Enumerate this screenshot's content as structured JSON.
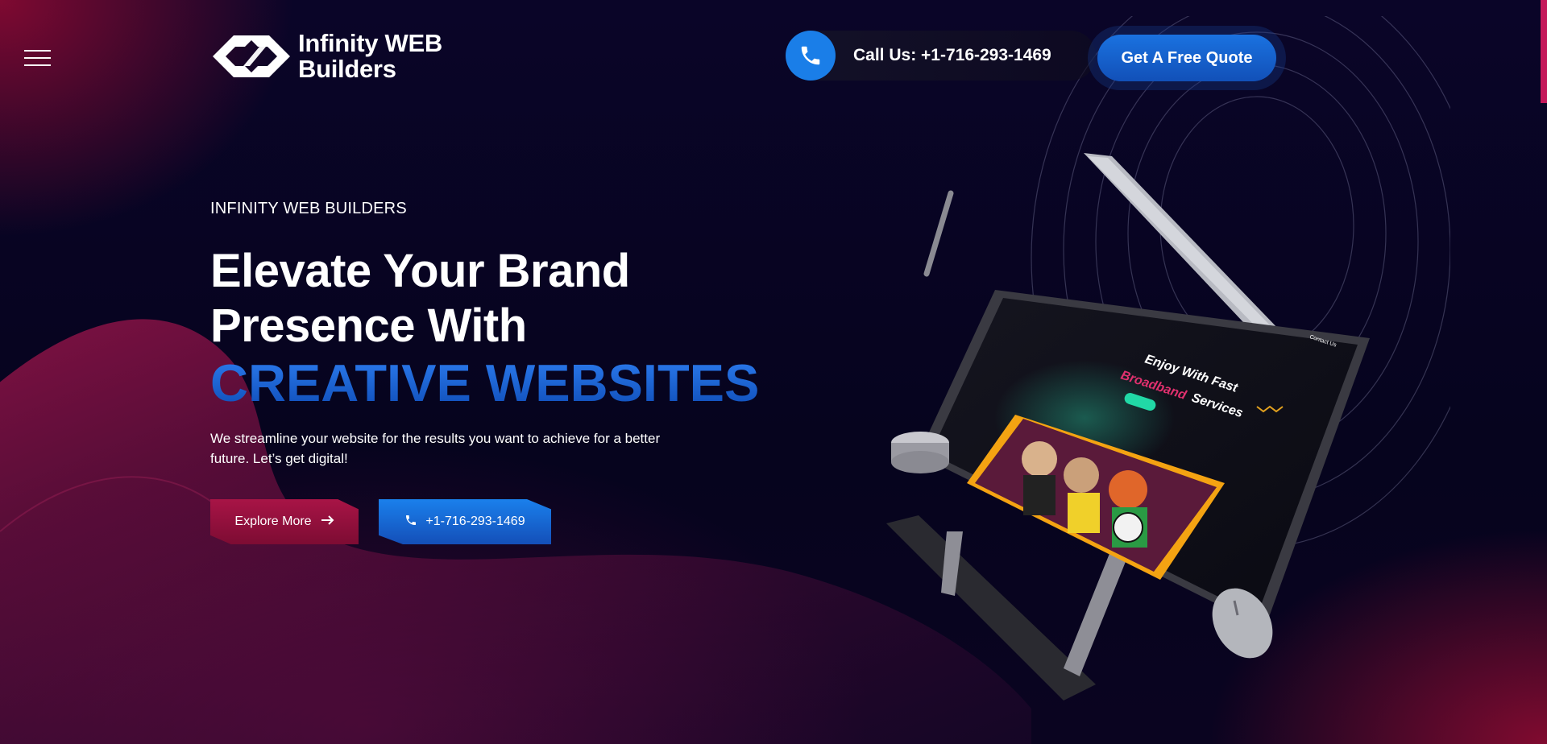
{
  "header": {
    "menu_icon": "hamburger-icon",
    "logo": {
      "line1": "Infinity WEB",
      "line2": "Builders"
    },
    "call": {
      "icon": "phone-icon",
      "text": "Call Us: +1-716-293-1469"
    },
    "quote_button": "Get A Free Quote"
  },
  "hero": {
    "eyebrow": "INFINITY WEB BUILDERS",
    "headline_line1": "Elevate Your Brand",
    "headline_line2": "Presence With",
    "headline_accent": "CREATIVE WEBSITES",
    "description": "We streamline your website for the results you want to achieve for a better future. Let’s get digital!",
    "explore_button": "Explore More",
    "phone_button": "+1-716-293-1469"
  },
  "illustration": {
    "screen_title": "Enjoy With Fast",
    "screen_accent": "Broadband",
    "screen_title_end": "Services",
    "screen_contact": "Contact Us"
  },
  "colors": {
    "accent_blue": "#1a72e0",
    "accent_crimson": "#a81446",
    "background": "#06041e"
  }
}
